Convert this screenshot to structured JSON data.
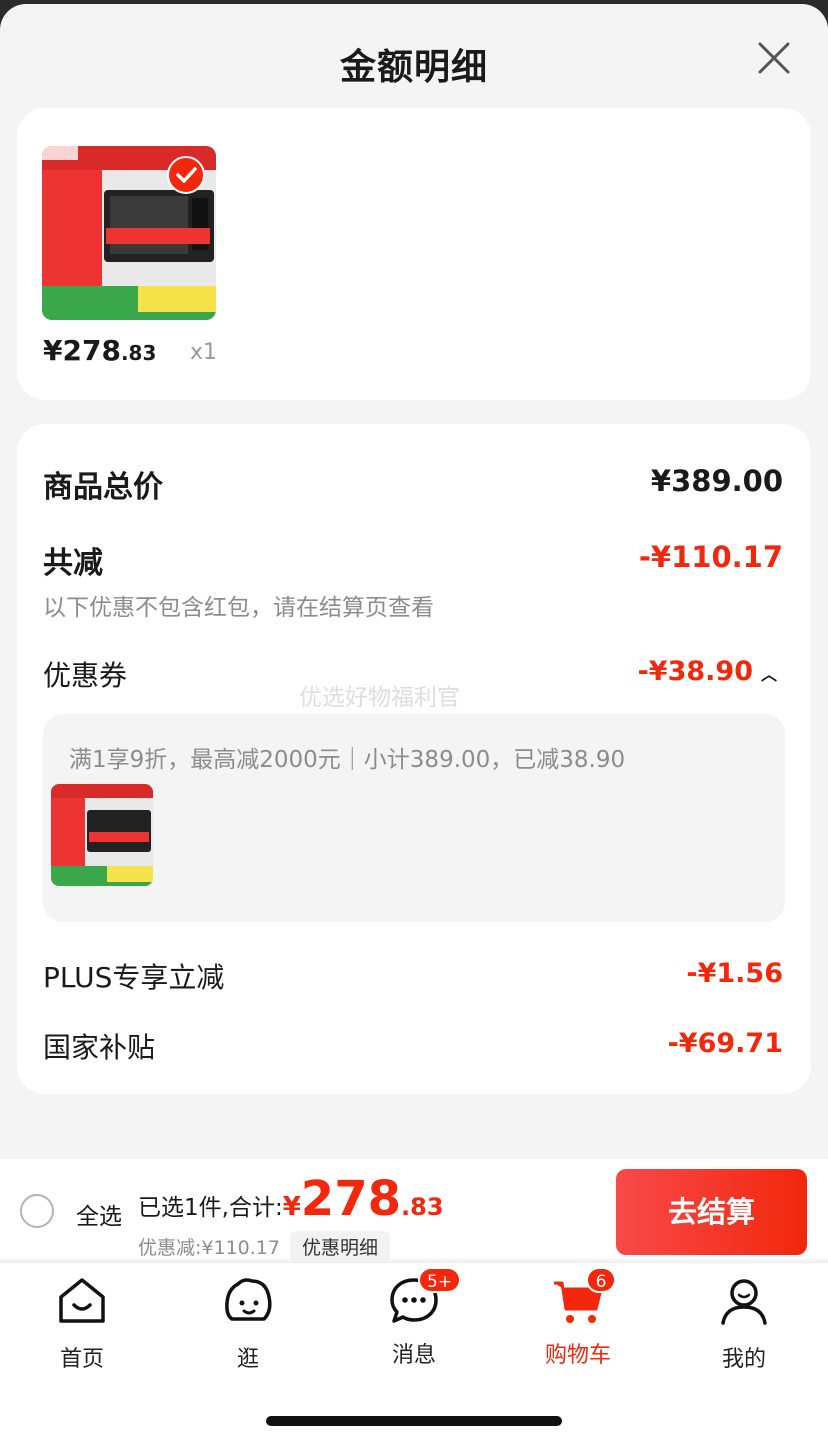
{
  "header": {
    "title": "金额明细"
  },
  "product": {
    "price_int": "¥278",
    "price_dec": ".83",
    "qty": "x1",
    "image_alt": "Midea microwave product image"
  },
  "summary": {
    "total_label": "商品总价",
    "total_value": "¥389.00",
    "reduce_label": "共减",
    "reduce_value": "-¥110.17",
    "note": "以下优惠不包含红包，请在结算页查看",
    "coupon_label": "优惠券",
    "coupon_value": "-¥38.90",
    "coupon_desc": "满1享9折，最高减2000元｜小计389.00，已减38.90",
    "plus_label": "PLUS专享立减",
    "plus_value": "-¥1.56",
    "subsidy_label": "国家补贴",
    "subsidy_value": "-¥69.71"
  },
  "watermark": "优选好物福利官",
  "bottom": {
    "select_all": "全选",
    "selected_prefix": "已选1件,合计:",
    "yen": "¥",
    "total_int": "278",
    "total_dec": ".83",
    "discount_text": "优惠减:¥110.17",
    "detail_tag": "优惠明细",
    "checkout": "去结算"
  },
  "tabs": [
    {
      "label": "首页",
      "icon": "home-icon"
    },
    {
      "label": "逛",
      "icon": "browse-icon"
    },
    {
      "label": "消息",
      "icon": "message-icon",
      "badge": "5+"
    },
    {
      "label": "购物车",
      "icon": "cart-icon",
      "badge": "6",
      "active": true
    },
    {
      "label": "我的",
      "icon": "profile-icon"
    }
  ],
  "colors": {
    "accent": "#f2270c",
    "bg": "#f4f4f4"
  }
}
